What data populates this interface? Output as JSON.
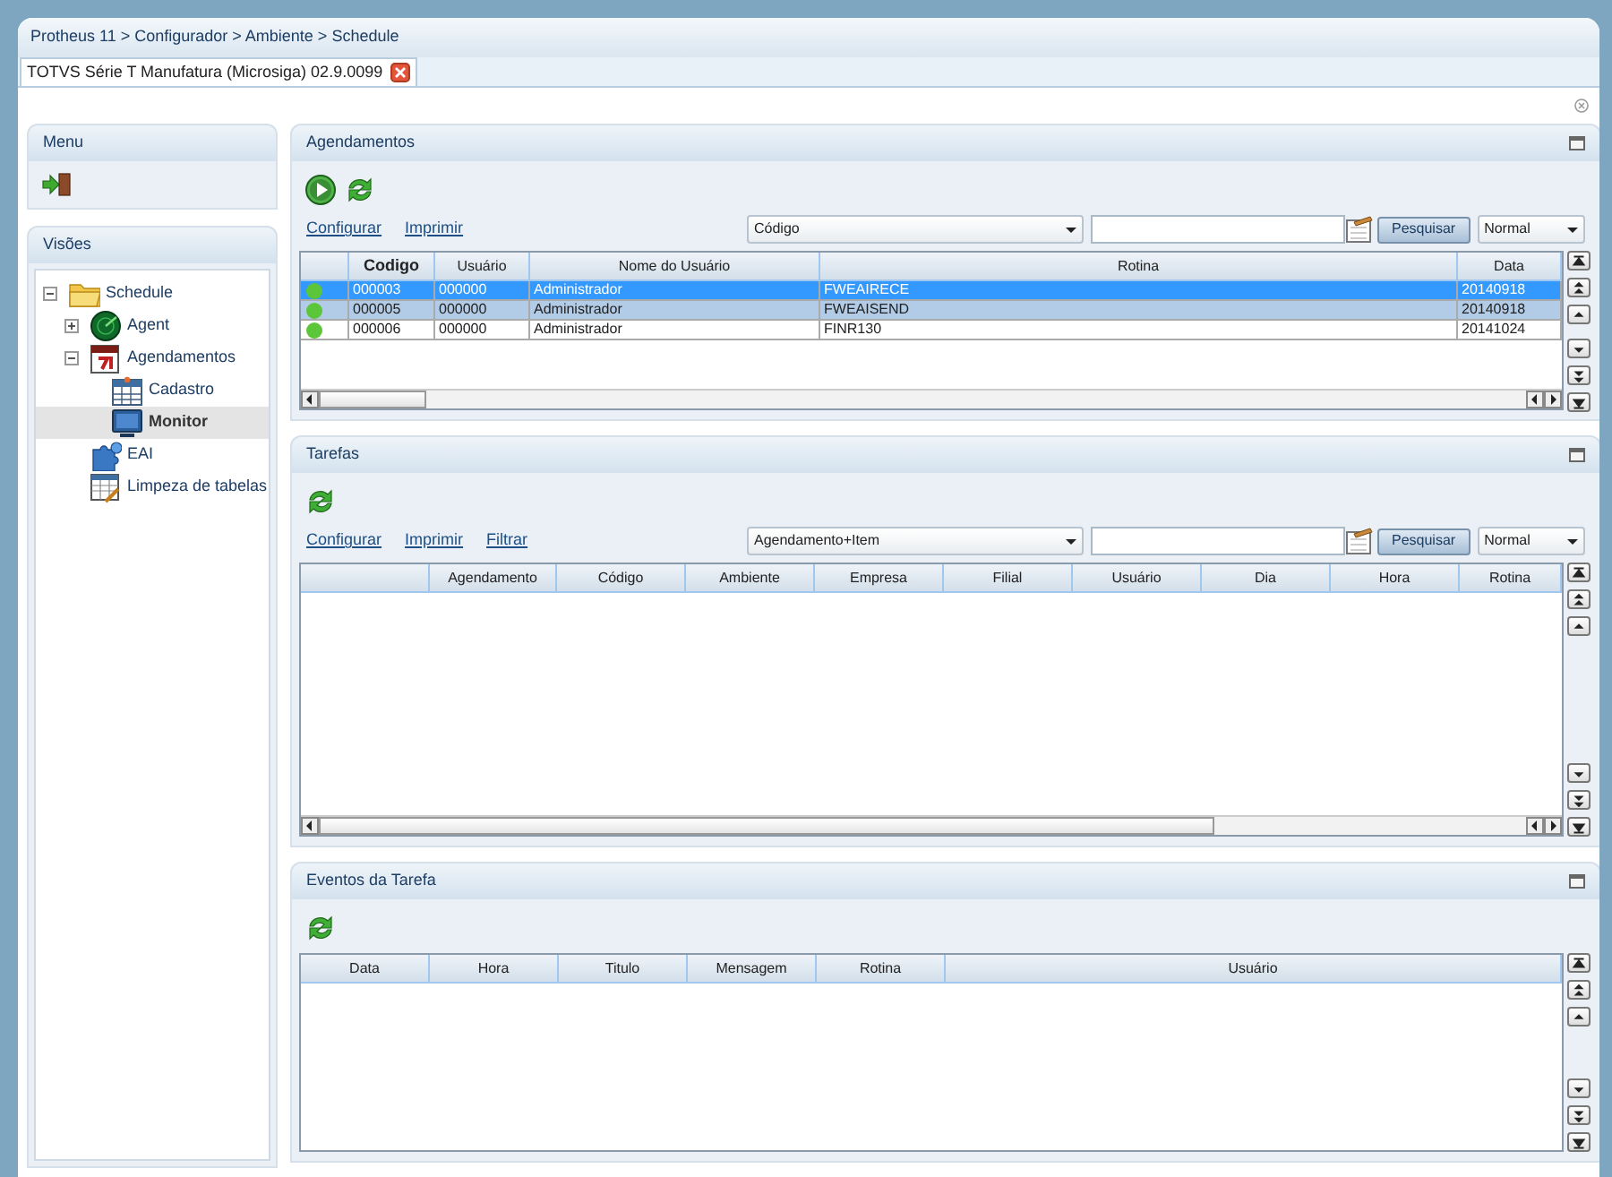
{
  "breadcrumb": "Protheus 11 > Configurador > Ambiente > Schedule",
  "tabs": [
    {
      "label": "TOTVS Série T Manufatura (Microsiga) 02.9.0099",
      "selected": true
    }
  ],
  "menu": {
    "title": "Menu"
  },
  "views": {
    "title": "Visões",
    "tree": [
      {
        "label": "Schedule",
        "kind": "folder",
        "expanded": true,
        "selected": false,
        "children": [
          {
            "label": "Agent",
            "kind": "radar",
            "expanded": false,
            "selected": false
          },
          {
            "label": "Agendamentos",
            "kind": "calendar",
            "expanded": true,
            "selected": false,
            "children": [
              {
                "label": "Cadastro",
                "kind": "grid",
                "selected": false
              },
              {
                "label": "Monitor",
                "kind": "monitor",
                "selected": true
              }
            ]
          },
          {
            "label": "EAI",
            "kind": "puzzle",
            "selected": false
          },
          {
            "label": "Limpeza de tabelas",
            "kind": "table",
            "selected": false
          }
        ]
      }
    ]
  },
  "panels": [
    {
      "title": "Agendamentos",
      "links": [
        "Configurar",
        "Imprimir"
      ],
      "search": {
        "order": "Código",
        "mode": "Normal",
        "button": "Pesquisar"
      },
      "table": {
        "columns": [
          "Codigo",
          "Usuário",
          "Nome do Usuário",
          "Rotina",
          "Data"
        ],
        "rows": [
          {
            "selected": true,
            "highlighted": false,
            "cells": [
              "000003",
              "000000",
              "Administrador",
              "FWEAIRECE",
              "20140918"
            ]
          },
          {
            "selected": false,
            "highlighted": true,
            "cells": [
              "000005",
              "000000",
              "Administrador",
              "FWEAISEND",
              "20140918"
            ]
          },
          {
            "selected": false,
            "highlighted": false,
            "cells": [
              "000006",
              "000000",
              "Administrador",
              "FINR130",
              "20141024"
            ]
          }
        ]
      }
    },
    {
      "title": "Tarefas",
      "links": [
        "Configurar",
        "Imprimir",
        "Filtrar"
      ],
      "search": {
        "order": "Agendamento+Item",
        "mode": "Normal",
        "button": "Pesquisar"
      },
      "table": {
        "columns": [
          "Agendamento",
          "Código",
          "Ambiente",
          "Empresa",
          "Filial",
          "Usuário",
          "Dia",
          "Hora",
          "Rotina"
        ]
      }
    },
    {
      "title": "Eventos da Tarefa",
      "table": {
        "columns": [
          "Data",
          "Hora",
          "Titulo",
          "Mensagem",
          "Rotina",
          "Usuário"
        ]
      }
    }
  ]
}
